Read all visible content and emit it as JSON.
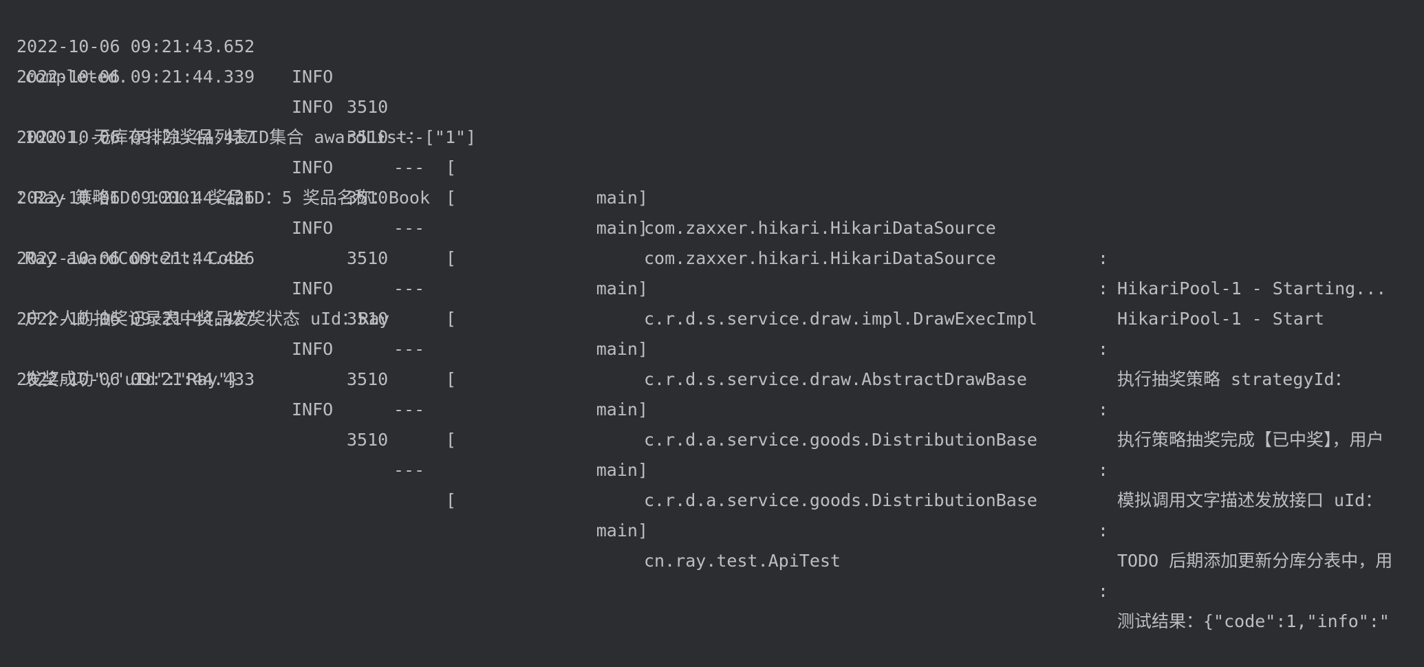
{
  "console": {
    "entries": [
      {
        "timestamp": "2022-10-06 09:21:43.652",
        "level": "INFO",
        "pid": "3510",
        "separator": "---",
        "bracket": "[",
        "thread": "main]",
        "logger": "com.zaxxer.hikari.HikariDataSource",
        "colon": ":",
        "message": "HikariPool-1 - Starting...",
        "continuation": ""
      },
      {
        "timestamp": "2022-10-06 09:21:44.339",
        "level": "INFO",
        "pid": "3510",
        "separator": "---",
        "bracket": "[",
        "thread": "main]",
        "logger": "com.zaxxer.hikari.HikariDataSource",
        "colon": ":",
        "message": "HikariPool-1 - Start",
        "continuation": "completed."
      },
      {
        "timestamp": "2022-10-06 09:21:44.417",
        "level": "INFO",
        "pid": "3510",
        "separator": "---",
        "bracket": "[",
        "thread": "main]",
        "logger": "c.r.d.s.service.draw.impl.DrawExecImpl",
        "colon": ":",
        "message": "执行抽奖策略 strategyId：",
        "continuation": "10001，无库存排除奖品列表ID集合 awardList：[\"1\"]"
      },
      {
        "timestamp": "2022-10-06 09:21:44.426",
        "level": "INFO",
        "pid": "3510",
        "separator": "---",
        "bracket": "[",
        "thread": "main]",
        "logger": "c.r.d.s.service.draw.AbstractDrawBase",
        "colon": ":",
        "message": "执行策略抽奖完成【已中奖】，用户",
        "continuation": "：Ray 策略ID：10001 奖品ID：5 奖品名称：Book"
      },
      {
        "timestamp": "2022-10-06 09:21:44.426",
        "level": "INFO",
        "pid": "3510",
        "separator": "---",
        "bracket": "[",
        "thread": "main]",
        "logger": "c.r.d.a.service.goods.DistributionBase",
        "colon": ":",
        "message": "模拟调用文字描述发放接口 uId：",
        "continuation": "Ray awardContent：Code"
      },
      {
        "timestamp": "2022-10-06 09:21:44.427",
        "level": "INFO",
        "pid": "3510",
        "separator": "---",
        "bracket": "[",
        "thread": "main]",
        "logger": "c.r.d.a.service.goods.DistributionBase",
        "colon": ":",
        "message": "TODO 后期添加更新分库分表中，用",
        "continuation": "户个人的抽奖记录表中奖品发奖状态 uId：Ray"
      },
      {
        "timestamp": "2022-10-06 09:21:44.433",
        "level": "INFO",
        "pid": "3510",
        "separator": "---",
        "bracket": "[",
        "thread": "main]",
        "logger": "cn.ray.test.ApiTest",
        "colon": ":",
        "message": "测试结果：{\"code\":1,\"info\":\"",
        "continuation": "发奖成功\",\"uId\":\"Ray\"}"
      }
    ]
  },
  "colors": {
    "background": "#2b2d30",
    "text": "#bcbec4"
  }
}
